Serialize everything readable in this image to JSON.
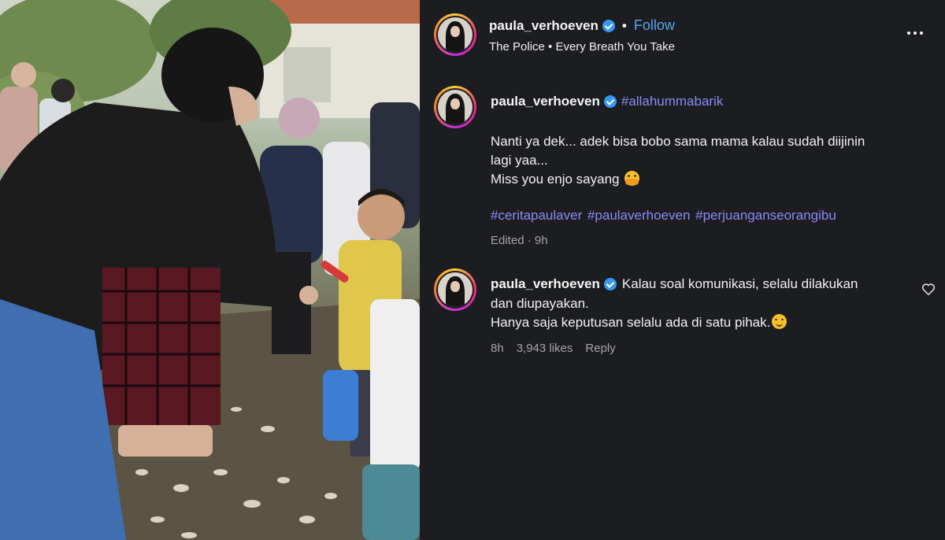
{
  "header": {
    "username": "paula_verhoeven",
    "separator": "•",
    "follow_label": "Follow",
    "audio": "The Police • Every Breath You Take",
    "more_icon": "more-horizontal-icon"
  },
  "caption": {
    "username": "paula_verhoeven",
    "hashtag": "#allahummabarik",
    "lines": [
      "Nanti ya dek... adek bisa bobo sama mama kalau sudah diijinin",
      "lagi yaa...",
      "Miss you enjo sayang"
    ],
    "hashtags": "#ceritapaulaver #paulaverhoeven #perjuanganseorangibu",
    "meta": "Edited · 9h"
  },
  "comment": {
    "username": "paula_verhoeven",
    "text_first": "Kalau soal komunikasi, selalu dilakukan",
    "text_lines": [
      "dan diupayakan.",
      "Hanya saja keputusan selalu ada di satu pihak."
    ],
    "time": "8h",
    "likes": "3,943 likes",
    "reply_label": "Reply"
  },
  "colors": {
    "panel_bg": "#1c1d20",
    "follow": "#5aa2f5",
    "hashtag": "#8a8af7",
    "verified": "#3897f0",
    "meta": "#a5a5a5"
  }
}
